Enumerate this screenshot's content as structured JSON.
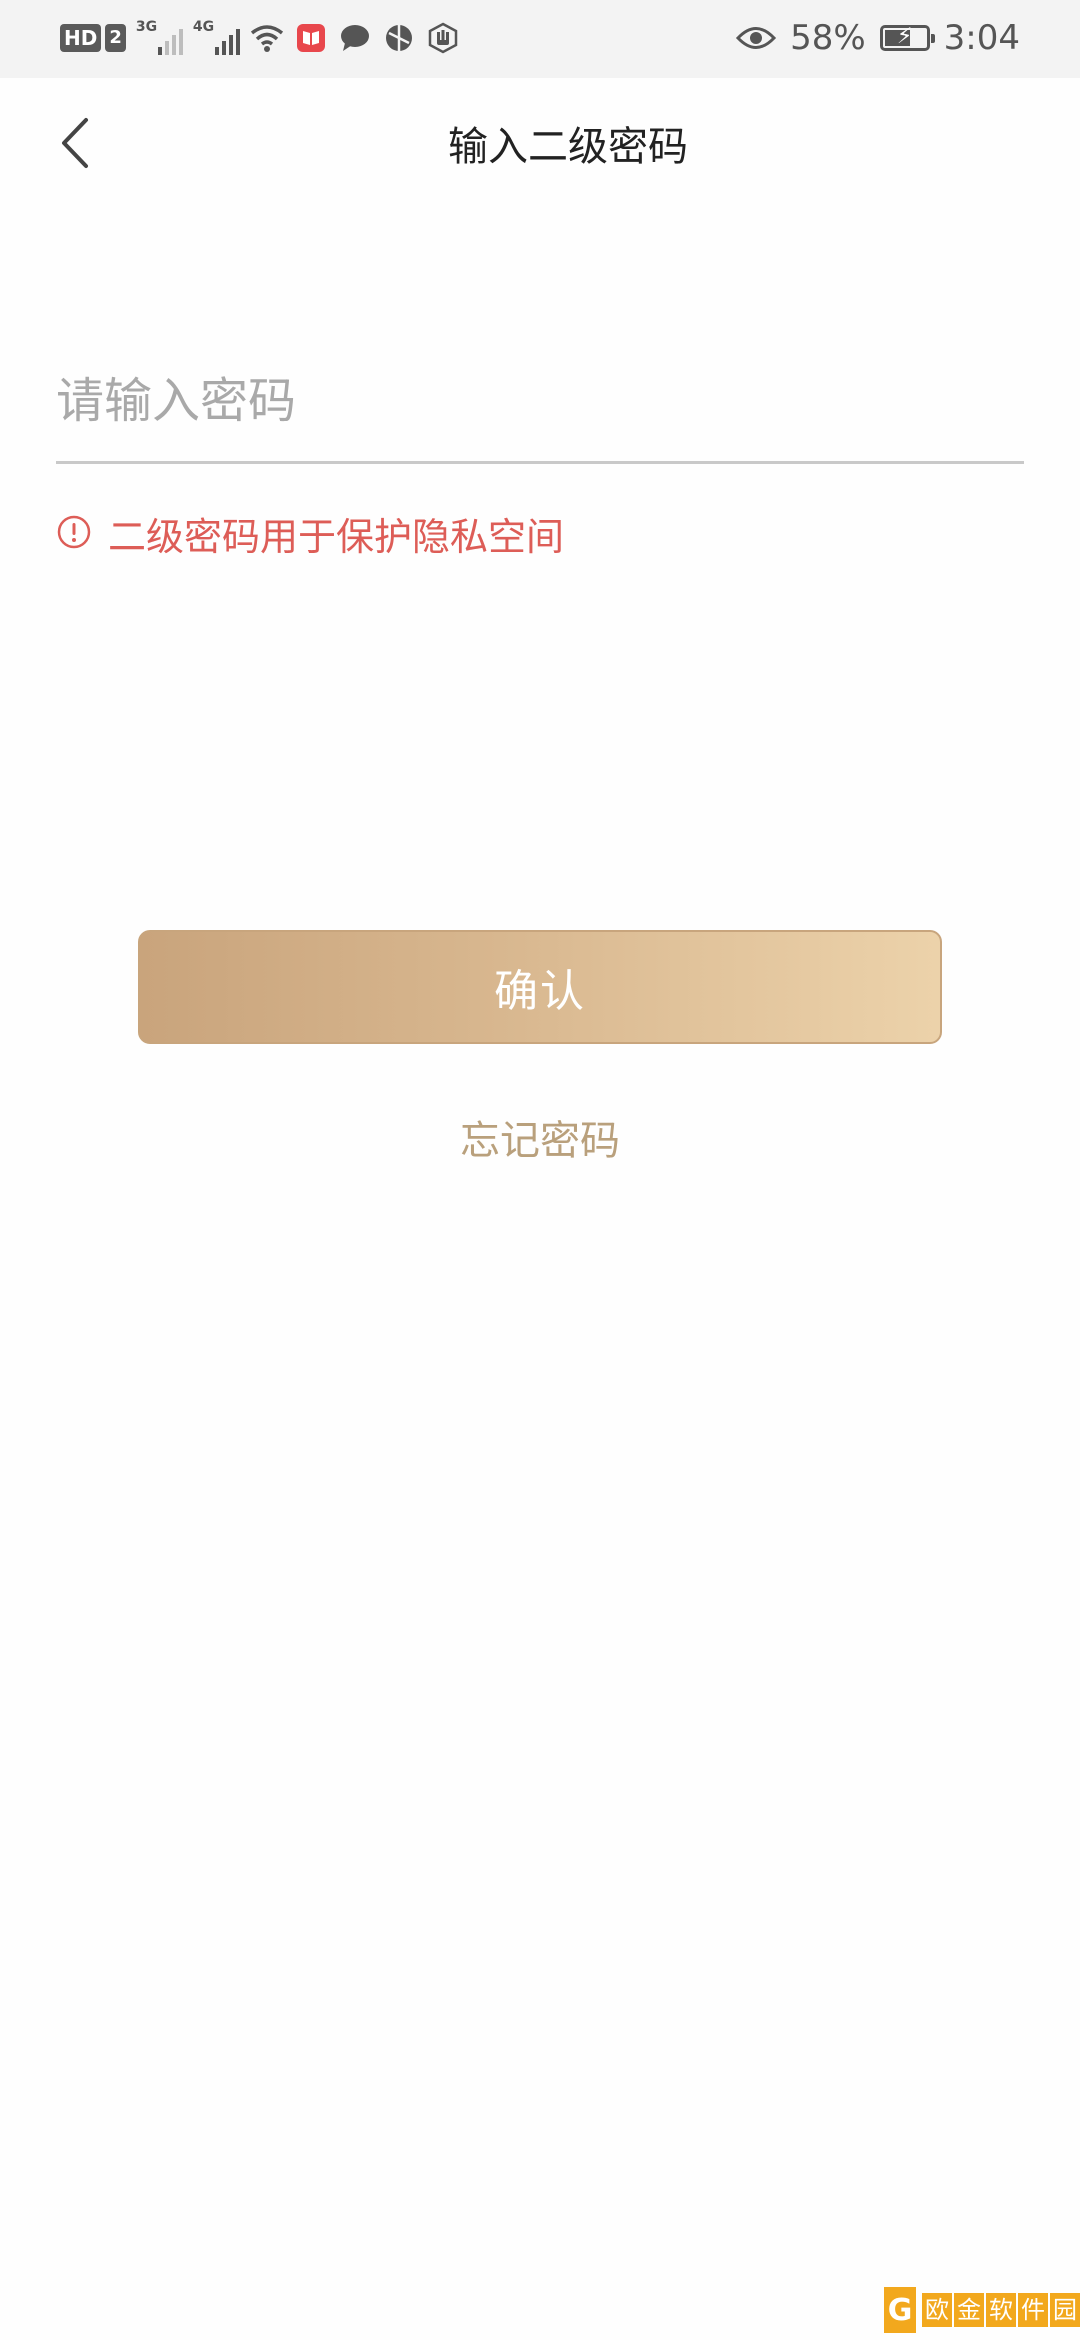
{
  "status_bar": {
    "hd_label": "HD",
    "sim_label": "2",
    "network_1": "3G",
    "network_2": "4G",
    "battery_percent": "58%",
    "battery_level": 0.58,
    "time": "3:04",
    "icons": [
      "wifi-icon",
      "book-app-icon",
      "chat-bubble-icon",
      "browser-icon",
      "hand-stop-icon",
      "eye-icon",
      "battery-charging-icon"
    ]
  },
  "nav": {
    "title": "输入二级密码"
  },
  "password": {
    "placeholder": "请输入密码",
    "value": ""
  },
  "hint": {
    "text": "二级密码用于保护隐私空间"
  },
  "confirm": {
    "label": "确认"
  },
  "forgot": {
    "label": "忘记密码"
  },
  "watermark": {
    "chars": [
      "欧",
      "金",
      "软",
      "件",
      "园"
    ]
  },
  "colors": {
    "accent_gold_start": "#c9a47c",
    "accent_gold_end": "#ecd2aa",
    "hint_red": "#dd5d57",
    "link_gold": "#b9a07c"
  }
}
